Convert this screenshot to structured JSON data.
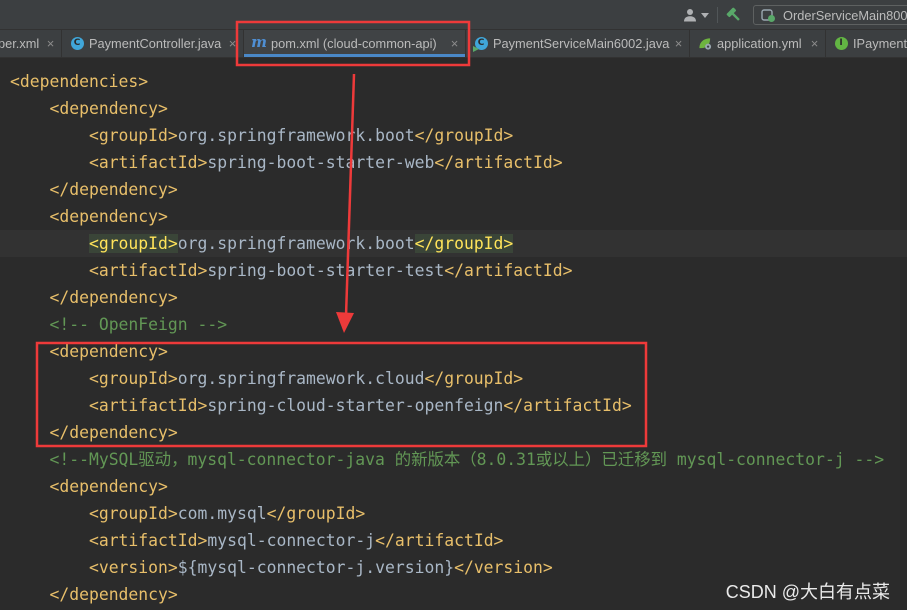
{
  "toolbar": {
    "user_icon": "user-icon",
    "build_icon": "hammer-icon",
    "run_config": {
      "label": "OrderServiceMain800",
      "icon": "run-config-icon"
    }
  },
  "tabs": [
    {
      "label": "per.xml",
      "active": false
    },
    {
      "label": "PaymentController.java",
      "icon": "class-icon",
      "glyph": "C",
      "active": false
    },
    {
      "label": "pom.xml (cloud-common-api)",
      "icon": "maven-icon",
      "glyph": "m",
      "active": true
    },
    {
      "label": "PaymentServiceMain6002.java",
      "icon": "runnable-class-icon",
      "glyph": "C",
      "active": false
    },
    {
      "label": "application.yml",
      "icon": "spring-config-icon",
      "active": false
    },
    {
      "label": "IPayment",
      "icon": "interface-icon",
      "glyph": "I",
      "active": false
    }
  ],
  "tab_close": "×",
  "editor": {
    "lines": [
      {
        "indent": "",
        "tokens": [
          {
            "kind": "tag",
            "text": "<dependencies>"
          }
        ]
      },
      {
        "indent": "    ",
        "tokens": [
          {
            "kind": "tag",
            "text": "<dependency>"
          }
        ]
      },
      {
        "indent": "        ",
        "tokens": [
          {
            "kind": "tag",
            "text": "<groupId>"
          },
          {
            "kind": "text",
            "text": "org.springframework.boot"
          },
          {
            "kind": "tag",
            "text": "</groupId>"
          }
        ]
      },
      {
        "indent": "        ",
        "tokens": [
          {
            "kind": "tag",
            "text": "<artifactId>"
          },
          {
            "kind": "text",
            "text": "spring-boot-starter-web"
          },
          {
            "kind": "tag",
            "text": "</artifactId>"
          }
        ]
      },
      {
        "indent": "    ",
        "tokens": [
          {
            "kind": "tag",
            "text": "</dependency>"
          }
        ]
      },
      {
        "indent": "    ",
        "tokens": [
          {
            "kind": "tag",
            "text": "<dependency>"
          }
        ]
      },
      {
        "indent": "        ",
        "caret": true,
        "tokens": [
          {
            "kind": "tag",
            "text": "<groupId>",
            "matched": true
          },
          {
            "kind": "text",
            "text": "org.springframework.boot"
          },
          {
            "kind": "tag",
            "text": "</groupId>",
            "matched": true
          }
        ]
      },
      {
        "indent": "        ",
        "tokens": [
          {
            "kind": "tag",
            "text": "<artifactId>"
          },
          {
            "kind": "text",
            "text": "spring-boot-starter-test"
          },
          {
            "kind": "tag",
            "text": "</artifactId>"
          }
        ]
      },
      {
        "indent": "    ",
        "tokens": [
          {
            "kind": "tag",
            "text": "</dependency>"
          }
        ]
      },
      {
        "indent": "    ",
        "tokens": [
          {
            "kind": "comment",
            "text": "<!-- OpenFeign -->"
          }
        ]
      },
      {
        "indent": "    ",
        "tokens": [
          {
            "kind": "tag",
            "text": "<dependency>"
          }
        ]
      },
      {
        "indent": "        ",
        "tokens": [
          {
            "kind": "tag",
            "text": "<groupId>"
          },
          {
            "kind": "text",
            "text": "org.springframework.cloud"
          },
          {
            "kind": "tag",
            "text": "</groupId>"
          }
        ]
      },
      {
        "indent": "        ",
        "tokens": [
          {
            "kind": "tag",
            "text": "<artifactId>"
          },
          {
            "kind": "text",
            "text": "spring-cloud-starter-openfeign"
          },
          {
            "kind": "tag",
            "text": "</artifactId>"
          }
        ]
      },
      {
        "indent": "    ",
        "tokens": [
          {
            "kind": "tag",
            "text": "</dependency>"
          }
        ]
      },
      {
        "indent": "    ",
        "tokens": [
          {
            "kind": "comment",
            "text": "<!--MySQL驱动，mysql-connector-java 的新版本（8.0.31或以上）已迁移到 mysql-connector-j -->"
          }
        ]
      },
      {
        "indent": "    ",
        "tokens": [
          {
            "kind": "tag",
            "text": "<dependency>"
          }
        ]
      },
      {
        "indent": "        ",
        "tokens": [
          {
            "kind": "tag",
            "text": "<groupId>"
          },
          {
            "kind": "text",
            "text": "com.mysql"
          },
          {
            "kind": "tag",
            "text": "</groupId>"
          }
        ]
      },
      {
        "indent": "        ",
        "tokens": [
          {
            "kind": "tag",
            "text": "<artifactId>"
          },
          {
            "kind": "text",
            "text": "mysql-connector-j"
          },
          {
            "kind": "tag",
            "text": "</artifactId>"
          }
        ]
      },
      {
        "indent": "        ",
        "tokens": [
          {
            "kind": "tag",
            "text": "<version>"
          },
          {
            "kind": "text",
            "text": "${mysql-connector-j.version}"
          },
          {
            "kind": "tag",
            "text": "</version>"
          }
        ]
      },
      {
        "indent": "    ",
        "tokens": [
          {
            "kind": "tag",
            "text": "</dependency>"
          }
        ]
      }
    ]
  },
  "colors": {
    "editor_background": "#2B2B2B",
    "xml_tag": "#E8BF6A",
    "xml_text": "#A9B7C6",
    "xml_comment": "#629755",
    "active_tab_underline": "#4A88C7",
    "annotation": "#EE3A3A"
  },
  "watermark": "CSDN @大白有点菜"
}
